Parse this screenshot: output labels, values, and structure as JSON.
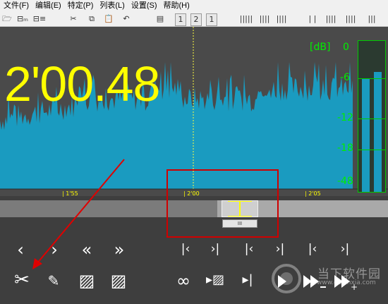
{
  "menu": [
    "文件(F)",
    "编辑(E)",
    "特定(P)",
    "列表(L)",
    "设置(S)",
    "帮助(H)"
  ],
  "toolbar": {
    "open": "🗁",
    "save": "⊟ₘ",
    "save_list": "⊟≡",
    "cut": "✂",
    "copy": "⧉",
    "paste": "📋",
    "undo": "↶",
    "page_view": "▤",
    "view1": "1",
    "view2": "2",
    "view3": "1",
    "wave_tools": [
      "|||||",
      "||||",
      "||||",
      "| |",
      "||||",
      "||||",
      "|||"
    ]
  },
  "display": {
    "time": "2'00.48",
    "db_unit": "[dB]",
    "db_scale": [
      "0",
      "-6",
      "-12",
      "-18",
      "-48"
    ],
    "timeline": [
      "| 1'55",
      "| 2'00",
      "| 2'05"
    ]
  },
  "scroll": {
    "thumb_label": "III"
  },
  "controls": {
    "row1": [
      "‹",
      "›",
      "«",
      "»",
      "|‹",
      "›|",
      "|‹",
      "›|",
      "|‹",
      "›|"
    ],
    "row2": [
      "✂",
      "✎",
      "▨",
      "▨",
      "∞",
      "▸▨",
      "▸|"
    ]
  },
  "watermark": {
    "text": "当下软件园",
    "url": "www.downxia.com"
  },
  "colors": {
    "waveform": "#1a9bc0",
    "time_text": "#ffff00",
    "meter": "#00cc00",
    "annotation": "#d00000"
  }
}
